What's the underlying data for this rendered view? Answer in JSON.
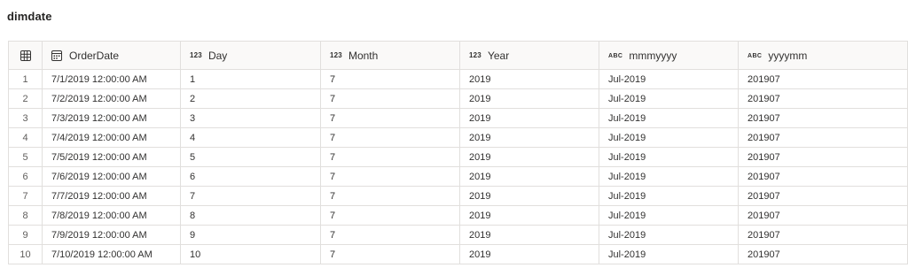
{
  "title": "dimdate",
  "columns": [
    {
      "label": "OrderDate",
      "type_icon": "calendar-icon"
    },
    {
      "label": "Day",
      "type_badge": "123"
    },
    {
      "label": "Month",
      "type_badge": "123"
    },
    {
      "label": "Year",
      "type_badge": "123"
    },
    {
      "label": "mmmyyyy",
      "type_badge": "ABC"
    },
    {
      "label": "yyyymm",
      "type_badge": "ABC"
    }
  ],
  "rows": [
    {
      "n": "1",
      "orderdate": "7/1/2019 12:00:00 AM",
      "day": "1",
      "month": "7",
      "year": "2019",
      "mmmyyyy": "Jul-2019",
      "yyyymm": "201907"
    },
    {
      "n": "2",
      "orderdate": "7/2/2019 12:00:00 AM",
      "day": "2",
      "month": "7",
      "year": "2019",
      "mmmyyyy": "Jul-2019",
      "yyyymm": "201907"
    },
    {
      "n": "3",
      "orderdate": "7/3/2019 12:00:00 AM",
      "day": "3",
      "month": "7",
      "year": "2019",
      "mmmyyyy": "Jul-2019",
      "yyyymm": "201907"
    },
    {
      "n": "4",
      "orderdate": "7/4/2019 12:00:00 AM",
      "day": "4",
      "month": "7",
      "year": "2019",
      "mmmyyyy": "Jul-2019",
      "yyyymm": "201907"
    },
    {
      "n": "5",
      "orderdate": "7/5/2019 12:00:00 AM",
      "day": "5",
      "month": "7",
      "year": "2019",
      "mmmyyyy": "Jul-2019",
      "yyyymm": "201907"
    },
    {
      "n": "6",
      "orderdate": "7/6/2019 12:00:00 AM",
      "day": "6",
      "month": "7",
      "year": "2019",
      "mmmyyyy": "Jul-2019",
      "yyyymm": "201907"
    },
    {
      "n": "7",
      "orderdate": "7/7/2019 12:00:00 AM",
      "day": "7",
      "month": "7",
      "year": "2019",
      "mmmyyyy": "Jul-2019",
      "yyyymm": "201907"
    },
    {
      "n": "8",
      "orderdate": "7/8/2019 12:00:00 AM",
      "day": "8",
      "month": "7",
      "year": "2019",
      "mmmyyyy": "Jul-2019",
      "yyyymm": "201907"
    },
    {
      "n": "9",
      "orderdate": "7/9/2019 12:00:00 AM",
      "day": "9",
      "month": "7",
      "year": "2019",
      "mmmyyyy": "Jul-2019",
      "yyyymm": "201907"
    },
    {
      "n": "10",
      "orderdate": "7/10/2019 12:00:00 AM",
      "day": "10",
      "month": "7",
      "year": "2019",
      "mmmyyyy": "Jul-2019",
      "yyyymm": "201907"
    }
  ]
}
